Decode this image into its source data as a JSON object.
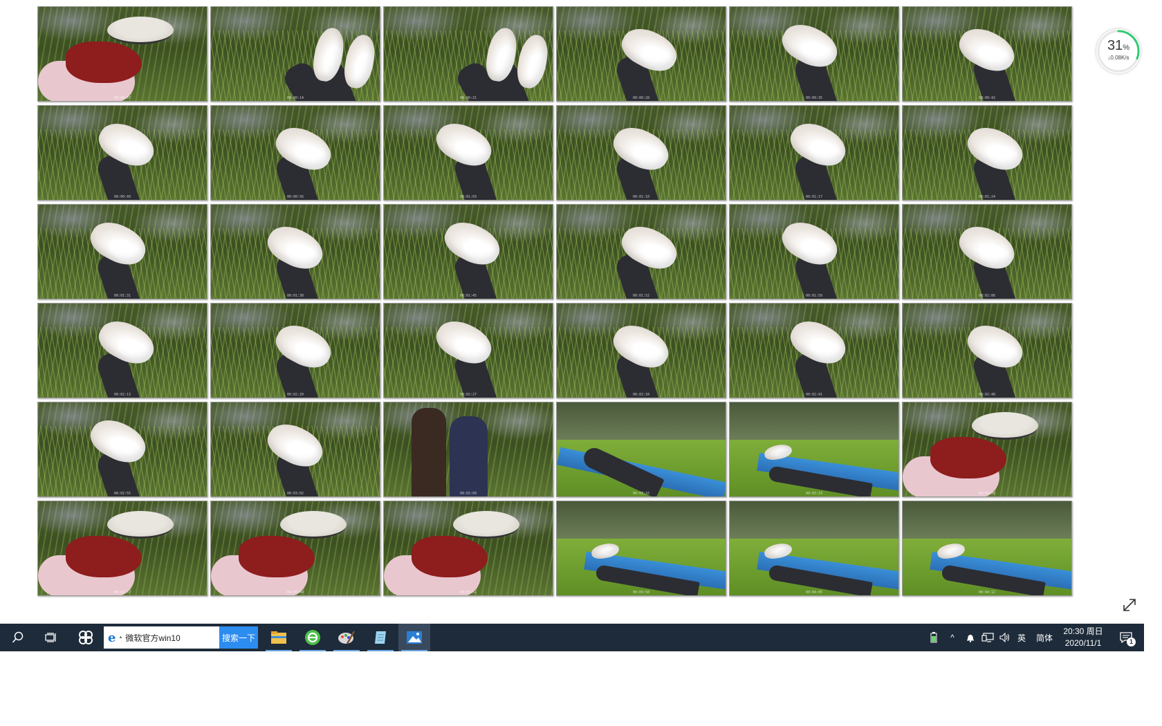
{
  "sheet": {
    "title": "",
    "thumbnails": [
      {
        "scene": "woman-hat",
        "timestamp": "00:00:07"
      },
      {
        "scene": "two-socks",
        "timestamp": "00:00:14"
      },
      {
        "scene": "two-socks",
        "timestamp": "00:00:21"
      },
      {
        "scene": "sock",
        "timestamp": "00:00:28"
      },
      {
        "scene": "sock",
        "timestamp": "00:00:35"
      },
      {
        "scene": "sock",
        "timestamp": "00:00:42"
      },
      {
        "scene": "sock",
        "timestamp": "00:00:49"
      },
      {
        "scene": "sock",
        "timestamp": "00:00:56"
      },
      {
        "scene": "sock",
        "timestamp": "00:01:03"
      },
      {
        "scene": "sock",
        "timestamp": "00:01:10"
      },
      {
        "scene": "sock",
        "timestamp": "00:01:17"
      },
      {
        "scene": "sock",
        "timestamp": "00:01:24"
      },
      {
        "scene": "sock",
        "timestamp": "00:01:31"
      },
      {
        "scene": "sock",
        "timestamp": "00:01:38"
      },
      {
        "scene": "sock",
        "timestamp": "00:01:45"
      },
      {
        "scene": "sock",
        "timestamp": "00:01:52"
      },
      {
        "scene": "sock",
        "timestamp": "00:01:59"
      },
      {
        "scene": "sock",
        "timestamp": "00:02:06"
      },
      {
        "scene": "sock",
        "timestamp": "00:02:13"
      },
      {
        "scene": "sock",
        "timestamp": "00:02:20"
      },
      {
        "scene": "sock",
        "timestamp": "00:02:27"
      },
      {
        "scene": "sock",
        "timestamp": "00:02:34"
      },
      {
        "scene": "sock",
        "timestamp": "00:02:41"
      },
      {
        "scene": "sock",
        "timestamp": "00:02:48"
      },
      {
        "scene": "sock",
        "timestamp": "00:02:55"
      },
      {
        "scene": "sock",
        "timestamp": "00:03:02"
      },
      {
        "scene": "couple",
        "timestamp": "00:03:09"
      },
      {
        "scene": "lying-mat",
        "timestamp": "00:03:16"
      },
      {
        "scene": "lying-grass",
        "timestamp": "00:03:23"
      },
      {
        "scene": "woman-hat",
        "timestamp": "00:03:30"
      },
      {
        "scene": "woman-hat",
        "timestamp": "00:03:37"
      },
      {
        "scene": "woman-hat",
        "timestamp": "00:03:44"
      },
      {
        "scene": "woman-hat",
        "timestamp": "00:03:51"
      },
      {
        "scene": "lying-grass",
        "timestamp": "00:03:58"
      },
      {
        "scene": "lying-grass",
        "timestamp": "00:04:05"
      },
      {
        "scene": "lying-grass",
        "timestamp": "00:04:12"
      }
    ]
  },
  "speed_widget": {
    "percent": "31",
    "percent_unit": "%",
    "rate": "↓0.08K/s",
    "ring_fraction": 0.31,
    "ring_color": "#2ecc71"
  },
  "expand_icon": "↗",
  "taskbar": {
    "search_icon": "search-icon",
    "search_text": "微软官方win10",
    "search_button": "搜索一下",
    "ie_glyph": "e",
    "apps": [
      {
        "name": "file-explorer-icon",
        "active": false
      },
      {
        "name": "browser-icon",
        "active": false
      },
      {
        "name": "paint-icon",
        "active": false
      },
      {
        "name": "notepad-icon",
        "active": false
      },
      {
        "name": "photos-icon",
        "active": true
      }
    ],
    "tray": {
      "chevron": "^",
      "volume": "🔈",
      "ime_lang": "英",
      "ime_mode": "简体"
    },
    "clock": {
      "time": "20:30 周日",
      "date": "2020/11/1"
    },
    "notifications_count": "1"
  }
}
